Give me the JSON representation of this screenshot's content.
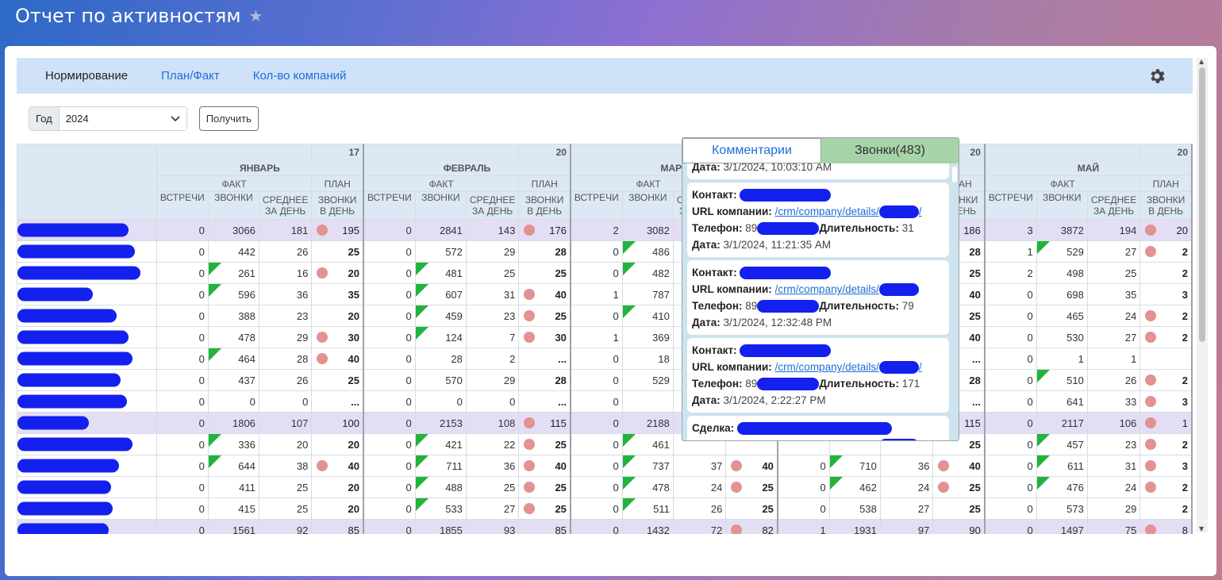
{
  "page": {
    "title": "Отчет по активностям"
  },
  "tabs": [
    {
      "label": "Нормирование",
      "active": true
    },
    {
      "label": "План/Факт",
      "active": false
    },
    {
      "label": "Кол-во компаний",
      "active": false
    }
  ],
  "filter": {
    "year_label": "Год",
    "year_value": "2024",
    "submit_label": "Получить"
  },
  "table": {
    "months": [
      {
        "name": "ЯНВАРЬ",
        "plan_days": "17"
      },
      {
        "name": "ФЕВРАЛЬ",
        "plan_days": "20"
      },
      {
        "name": "МАРТ",
        "plan_days": ""
      },
      {
        "name": "АПРЕЛЬ",
        "plan_days": "20"
      },
      {
        "name": "МАЙ",
        "plan_days": "20"
      }
    ],
    "headers": {
      "fact": "ФАКТ",
      "plan": "ПЛАН",
      "meetings": "ВСТРЕЧИ",
      "calls": "ЗВОНКИ",
      "avg_per_day": "СРЕДНЕЕ ЗА ДЕНЬ",
      "calls_per_day": "ЗВОНКИ В ДЕНЬ"
    },
    "rows": [
      {
        "group": true,
        "m": [
          [
            "0",
            "3066",
            "181",
            "195",
            "dot"
          ],
          [
            "0",
            "2841",
            "143",
            "176",
            "dot"
          ],
          [
            "2",
            "3082",
            "",
            "",
            ""
          ],
          [
            "",
            "",
            "",
            "186",
            "dot"
          ],
          [
            "3",
            "3872",
            "194",
            "20",
            "dot"
          ]
        ]
      },
      {
        "group": false,
        "m": [
          [
            "0",
            "442",
            "26",
            "25",
            ""
          ],
          [
            "0",
            "572",
            "29",
            "28",
            ""
          ],
          [
            "0",
            "486",
            "",
            "",
            "tri"
          ],
          [
            "",
            "",
            "",
            "28",
            ""
          ],
          [
            "1",
            "529",
            "27",
            "2",
            "dot",
            "tri"
          ]
        ]
      },
      {
        "group": false,
        "m": [
          [
            "0",
            "261",
            "16",
            "20",
            "dot",
            "tri"
          ],
          [
            "0",
            "481",
            "25",
            "25",
            "",
            "tri"
          ],
          [
            "0",
            "482",
            "",
            "",
            "tri"
          ],
          [
            "",
            "",
            "",
            "25",
            ""
          ],
          [
            "2",
            "498",
            "25",
            "2",
            ""
          ]
        ]
      },
      {
        "group": false,
        "m": [
          [
            "0",
            "596",
            "36",
            "35",
            "",
            "tri"
          ],
          [
            "0",
            "607",
            "31",
            "40",
            "dot",
            "tri"
          ],
          [
            "1",
            "787",
            "",
            "",
            ""
          ],
          [
            "",
            "",
            "",
            "40",
            ""
          ],
          [
            "0",
            "698",
            "35",
            "3",
            ""
          ]
        ]
      },
      {
        "group": false,
        "m": [
          [
            "0",
            "388",
            "23",
            "20",
            ""
          ],
          [
            "0",
            "459",
            "23",
            "25",
            "dot",
            "tri"
          ],
          [
            "0",
            "410",
            "",
            "",
            "tri"
          ],
          [
            "",
            "",
            "",
            "25",
            ""
          ],
          [
            "0",
            "465",
            "24",
            "2",
            "dot"
          ]
        ]
      },
      {
        "group": false,
        "m": [
          [
            "0",
            "478",
            "29",
            "30",
            "dot"
          ],
          [
            "0",
            "124",
            "7",
            "30",
            "dot",
            "tri"
          ],
          [
            "1",
            "369",
            "",
            "",
            ""
          ],
          [
            "",
            "",
            "",
            "40",
            "dot"
          ],
          [
            "0",
            "530",
            "27",
            "2",
            "dot"
          ]
        ]
      },
      {
        "group": false,
        "m": [
          [
            "0",
            "464",
            "28",
            "40",
            "dot",
            "tri"
          ],
          [
            "0",
            "28",
            "2",
            "...",
            ""
          ],
          [
            "0",
            "18",
            "",
            "",
            ""
          ],
          [
            "",
            "",
            "",
            "...",
            ""
          ],
          [
            "0",
            "1",
            "1",
            "",
            ""
          ]
        ]
      },
      {
        "group": false,
        "m": [
          [
            "0",
            "437",
            "26",
            "25",
            ""
          ],
          [
            "0",
            "570",
            "29",
            "28",
            ""
          ],
          [
            "0",
            "529",
            "",
            "",
            ""
          ],
          [
            "",
            "",
            "",
            "28",
            "dot"
          ],
          [
            "0",
            "510",
            "26",
            "2",
            "dot",
            "tri"
          ]
        ]
      },
      {
        "group": false,
        "m": [
          [
            "0",
            "0",
            "0",
            "...",
            ""
          ],
          [
            "0",
            "0",
            "0",
            "...",
            ""
          ],
          [
            "0",
            "",
            "",
            "",
            ""
          ],
          [
            "",
            "",
            "",
            "...",
            ""
          ],
          [
            "0",
            "641",
            "33",
            "3",
            "dot"
          ]
        ]
      },
      {
        "group": true,
        "m": [
          [
            "0",
            "1806",
            "107",
            "100",
            ""
          ],
          [
            "0",
            "2153",
            "108",
            "115",
            "dot"
          ],
          [
            "0",
            "2188",
            "",
            "",
            ""
          ],
          [
            "",
            "",
            "",
            "115",
            "dot"
          ],
          [
            "0",
            "2117",
            "106",
            "1",
            "dot"
          ]
        ]
      },
      {
        "group": false,
        "m": [
          [
            "0",
            "336",
            "20",
            "20",
            "",
            "tri"
          ],
          [
            "0",
            "421",
            "22",
            "25",
            "dot",
            "tri"
          ],
          [
            "0",
            "461",
            "",
            "",
            "tri"
          ],
          [
            "",
            "",
            "",
            "25",
            ""
          ],
          [
            "0",
            "457",
            "23",
            "2",
            "dot",
            "tri"
          ]
        ]
      },
      {
        "group": false,
        "m": [
          [
            "0",
            "644",
            "38",
            "40",
            "dot",
            "tri"
          ],
          [
            "0",
            "711",
            "36",
            "40",
            "dot",
            "tri"
          ],
          [
            "0",
            "737",
            "37",
            "40",
            "dot",
            "tri"
          ],
          [
            "0",
            "710",
            "36",
            "40",
            "dot",
            "tri"
          ],
          [
            "0",
            "611",
            "31",
            "3",
            "dot",
            "tri"
          ]
        ]
      },
      {
        "group": false,
        "m": [
          [
            "0",
            "411",
            "25",
            "20",
            ""
          ],
          [
            "0",
            "488",
            "25",
            "25",
            "dot",
            "tri"
          ],
          [
            "0",
            "478",
            "24",
            "25",
            "dot",
            "tri"
          ],
          [
            "0",
            "462",
            "24",
            "25",
            "dot",
            "tri"
          ],
          [
            "0",
            "476",
            "24",
            "2",
            "dot",
            "tri"
          ]
        ]
      },
      {
        "group": false,
        "m": [
          [
            "0",
            "415",
            "25",
            "20",
            ""
          ],
          [
            "0",
            "533",
            "27",
            "25",
            "dot",
            "tri"
          ],
          [
            "0",
            "511",
            "26",
            "25",
            "",
            "tri"
          ],
          [
            "0",
            "538",
            "27",
            "25",
            ""
          ],
          [
            "0",
            "573",
            "29",
            "2",
            ""
          ]
        ]
      },
      {
        "group": true,
        "m": [
          [
            "0",
            "1561",
            "92",
            "85",
            ""
          ],
          [
            "0",
            "1855",
            "93",
            "85",
            ""
          ],
          [
            "0",
            "1432",
            "72",
            "82",
            "dot"
          ],
          [
            "1",
            "1931",
            "97",
            "90",
            ""
          ],
          [
            "0",
            "1497",
            "75",
            "8",
            "dot"
          ]
        ]
      }
    ]
  },
  "popup": {
    "tab_comments": "Комментарии",
    "tab_calls": "Звонки(483)",
    "labels": {
      "contact": "Контакт:",
      "deal": "Сделка:",
      "company_url": "URL компании:",
      "phone": "Телефон:",
      "duration": "Длительность:",
      "date": "Дата:"
    },
    "first_date": "3/1/2024, 10:03:10 AM",
    "calls": [
      {
        "kind": "contact",
        "url": "/crm/company/details/",
        "url_tail": "/",
        "phone": "89",
        "duration": "31",
        "date": "3/1/2024, 11:21:35 AM"
      },
      {
        "kind": "contact",
        "url": "/crm/company/details/",
        "url_tail": "",
        "phone": "89",
        "duration": "79",
        "date": "3/1/2024, 12:32:48 PM"
      },
      {
        "kind": "contact",
        "url": "/crm/company/details/",
        "url_tail": "/",
        "phone": "89",
        "duration": "171",
        "date": "3/1/2024, 2:22:27 PM"
      },
      {
        "kind": "deal",
        "url": "/crm/company/details/",
        "url_tail": "",
        "phone": "",
        "duration": "",
        "date": ""
      }
    ]
  },
  "colors": {
    "blue_header": "#d0e2fa",
    "group_row": "#e3def4",
    "dot": "#e29292",
    "triangle": "#22b33c",
    "redaction": "#1320ee"
  }
}
